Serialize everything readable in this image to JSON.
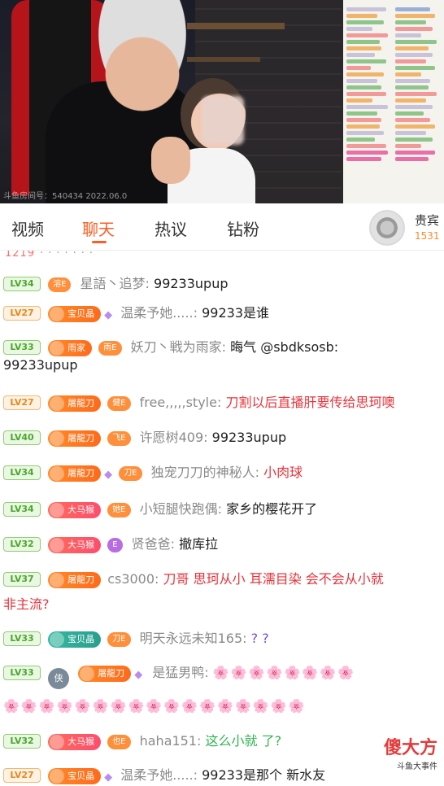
{
  "video": {
    "watermark": "斗鱼房间号：540434   2022.06.0"
  },
  "tabs": [
    {
      "label": "视频"
    },
    {
      "label": "聊天"
    },
    {
      "label": "热议"
    },
    {
      "label": "钻粉"
    }
  ],
  "vip": {
    "label": "贵宾",
    "count": "1531"
  },
  "chat": {
    "cutoff_text": "1219",
    "messages": [
      {
        "level": "LV34",
        "tag": "溶E",
        "name": "星語丶追梦:",
        "text": "99233upup"
      },
      {
        "level": "LV27",
        "fan": "宝贝晶",
        "name": "温柔予她.....:",
        "text": "99233是谁"
      },
      {
        "level": "LV33",
        "fan": "雨家",
        "tag": "雨E",
        "name": "妖刀丶戦为雨家:",
        "text": "晦气 @sbdksosb:",
        "text2": "99233upup"
      },
      {
        "level": "LV27",
        "fan": "屠龍刀",
        "tag": "健E",
        "name": "free,,,,,style:",
        "text": "刀割以后直播肝要传给思珂噢"
      },
      {
        "level": "LV40",
        "fan": "屠龍刀",
        "tag": "飞E",
        "name": "许愿树409:",
        "text": "99233upup"
      },
      {
        "level": "LV34",
        "fan": "屠龍刀",
        "tag": "刀E",
        "name": "独宠刀刀的神秘人:",
        "text": "小肉球"
      },
      {
        "level": "LV34",
        "fan": "大马猴",
        "tag": "她E",
        "name": "小短腿快跑偶:",
        "text": "家乡的樱花开了"
      },
      {
        "level": "LV32",
        "fan": "大马猴",
        "tag": "E",
        "name": "贤爸爸:",
        "text": "撤库拉"
      },
      {
        "level": "LV37",
        "fan": "屠龍刀",
        "name": "cs3000:",
        "text": "刀哥 思珂从小 耳濡目染 会不会从小就",
        "text2": "非主流?"
      },
      {
        "level": "LV33",
        "fan": "宝贝晶",
        "tag": "刀E",
        "name": "明天永远未知165:",
        "text": "? ?"
      },
      {
        "level": "LV33",
        "round": "侠",
        "fan": "屠龍刀",
        "name": "是猛男鸭:",
        "text": "🌸🌸🌸🌸🌸🌸🌸🌸",
        "text2": "🌸🌸🌸🌸🌸🌸🌸🌸🌸🌸🌸🌸🌸🌸🌸🌸🌸"
      },
      {
        "level": "LV32",
        "fan": "大马猴",
        "tag": "也E",
        "name": "haha151:",
        "text": "这么小就 了?"
      },
      {
        "level": "LV27",
        "fan": "宝贝晶",
        "name": "温柔予她.....:",
        "text": "99233是那个  新水友"
      }
    ]
  },
  "brand": {
    "main": "傻大方",
    "sub": "斗鱼大事件"
  },
  "colors": {
    "accent": "#ff5d23",
    "level_green": "#4aa82c",
    "level_orange": "#e8871e",
    "msg_red": "#e8333b",
    "msg_green": "#2fb34f"
  }
}
